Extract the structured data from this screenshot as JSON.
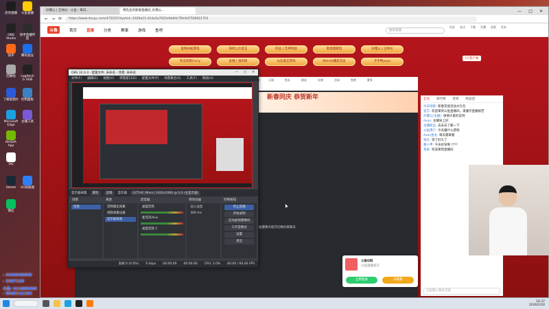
{
  "desktop": {
    "icons": [
      {
        "label": "虎牙直播",
        "color": "#1d1d1d"
      },
      {
        "label": "斗鱼直播",
        "color": "#ffcc00"
      },
      {
        "label": "OBS Studio",
        "color": "#222"
      },
      {
        "label": "快手直播伴侣",
        "color": "#2d2d2d"
      },
      {
        "label": "快手",
        "color": "#ff6a1a"
      },
      {
        "label": "腾讯会议",
        "color": "#1e6ee8"
      },
      {
        "label": "回收站",
        "color": "#aaaaaa"
      },
      {
        "label": "Logitech G HUB",
        "color": "#222"
      },
      {
        "label": "了解此图片",
        "color": "#2a5bd7"
      },
      {
        "label": "控制面板",
        "color": "#3b82c4"
      },
      {
        "label": "Microsoft Edge",
        "color": "#1ba1e2"
      },
      {
        "label": "主播工具",
        "color": "#7a59d9"
      },
      {
        "label": "NVIDIA App",
        "color": "#76b900"
      },
      {
        "label": "QQ",
        "color": "#fff"
      },
      {
        "label": "Steam",
        "color": "#1b2838"
      },
      {
        "label": "UU加速器",
        "color": "#2d7ff9"
      },
      {
        "label": "微信",
        "color": "#07c160"
      }
    ],
    "notes": [
      "- 4443060099",
      "- 3387128",
      "斗鱼: 611880489",
      "- 5058111184",
      "快手: 5498132"
    ]
  },
  "browser": {
    "tabs": [
      "孙儒公 | 王林仪 - 斗鱼 - 每日...",
      "傅先生的新春直播间_孙儒公..."
    ],
    "url": "https://www.douyu.com/475252?dyshid=1029a21-d14a2a7025e9a0dc7f0c0d7500021701",
    "window_controls": [
      "—",
      "□",
      "✕"
    ]
  },
  "site": {
    "logo": "斗鱼",
    "nav": [
      "首页",
      "直播",
      "分类",
      "赛事",
      "游戏",
      "鱼吧"
    ],
    "search_placeholder": "搜索直播",
    "icons": [
      "历史",
      "关注",
      "下载",
      "开播",
      "消息",
      "任务"
    ],
    "chips": [
      "金和蚂蚁游戏",
      "琦鸣儿大星王",
      "阿主 | 吉神阿勋",
      "斯坦德斯坦",
      "孙儒公 | 王林仪",
      "阿瓜阿斯Cerry",
      "丞相 | 张阳阳",
      "山东毒王苏阳",
      "Wendo魏延司主",
      "子子鸭yoyo"
    ],
    "pc_button": "PC客户端",
    "gift_labels": [
      "直播玩法",
      "订阅",
      "鱼丸",
      "粉丝",
      "礼物",
      "活动",
      "鱼吧",
      "更多"
    ],
    "banner": "新春同庆 恭贺新年"
  },
  "chat": {
    "tabs": [
      "互动",
      "排行榜",
      "贵宾",
      "粉丝团"
    ],
    "messages": [
      {
        "user": "今日领取:",
        "text": "新春充值活动大礼包"
      },
      {
        "user": "官方:",
        "text": "欢迎来到斗鱼直播间，请遵守直播规范"
      },
      {
        "user": "孙儒公(主播):",
        "text": "谢谢大家的支持"
      },
      {
        "user": "Avan:",
        "text": "主播早上好"
      },
      {
        "user": "主播粉丝:",
        "text": "去去去了解一下"
      },
      {
        "user": "斗鱼用户:",
        "text": "今天播什么游戏"
      },
      {
        "user": "Avan鱼丸:",
        "text": "每天都来看"
      },
      {
        "user": "观众:",
        "text": "等了好久了"
      },
      {
        "user": "路人甲:",
        "text": "今天好早啊 ????"
      },
      {
        "user": "系统:",
        "text": "欢迎来到直播间"
      }
    ],
    "input_placeholder": "这里输入聊天内容"
  },
  "popup": {
    "title": "斗鱼Q码",
    "subtitle": "斗鱼直播官方",
    "btn_left": "立即登录",
    "btn_right": "去看看"
  },
  "obs": {
    "title": "OBS 32.0.4 - 配置文件: 未命名 - 场景: 未命名",
    "menu": [
      "文件(F)",
      "编辑(E)",
      "视图(V)",
      "停靠窗口(D)",
      "配置文件(P)",
      "场景集合(S)",
      "工具(T)",
      "帮助(H)"
    ],
    "src_bar": [
      "显示器采集",
      "属性",
      "滤镜",
      "显示器",
      "GZTHO (Main) 1920x1080 @ 0,0 (主显示器)"
    ],
    "docks": {
      "scenes": {
        "title": "场景",
        "items": [
          "场景"
        ]
      },
      "sources": {
        "title": "来源",
        "items": [
          "音频输出采集",
          "视频采集设备",
          "显示器采集"
        ]
      },
      "mixer": {
        "title": "混音器",
        "items": [
          "桌面音频",
          "麦克风/Aux",
          "桌面音频 2"
        ],
        "levels": [
          "0.0 dB",
          "0.0 dB",
          "0.0 dB"
        ]
      },
      "transitions": {
        "title": "转场动画",
        "items": [
          "淡入淡出"
        ],
        "duration": "300 ms"
      },
      "controls": {
        "title": "控制按钮",
        "buttons": [
          "停止直播",
          "开始录制",
          "启动虚拟摄像机",
          "工作室模式",
          "设置",
          "退出"
        ]
      }
    },
    "status": [
      "丢帧 0 (0.0%)",
      "0 kbps",
      "00:00:00",
      "00:00:00",
      "CPU: 2.0%",
      "60.00 / 60.00 FPS"
    ]
  },
  "chat_hint": "右键聊天框可切换旧版聊天",
  "taskbar": {
    "time": "16:37",
    "date": "2026/2/20"
  }
}
